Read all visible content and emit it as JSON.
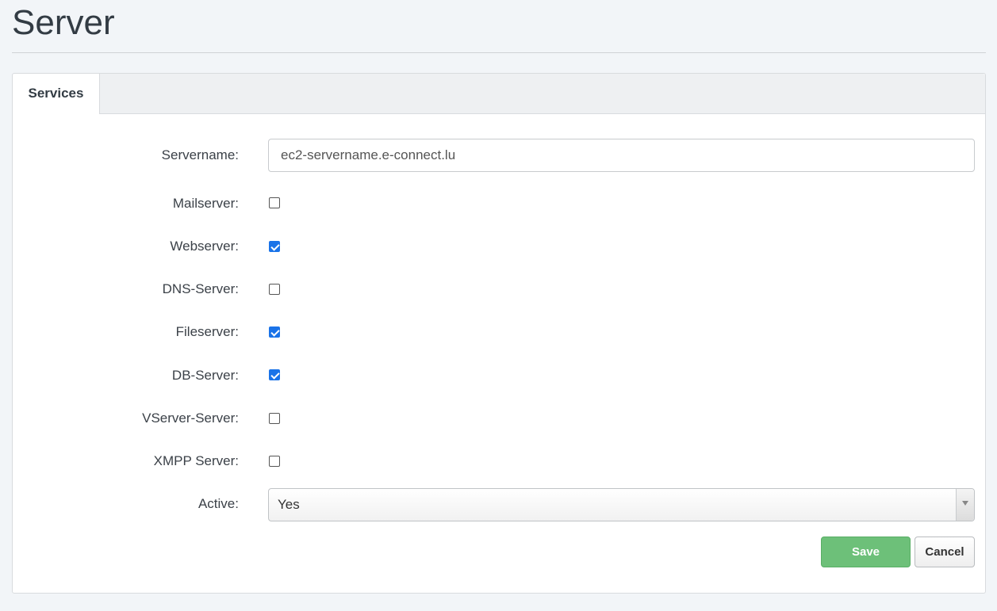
{
  "page": {
    "title": "Server"
  },
  "tabs": [
    {
      "label": "Services",
      "active": true
    }
  ],
  "form": {
    "servername": {
      "label": "Servername:",
      "value": "ec2-servername.e-connect.lu"
    },
    "mailserver": {
      "label": "Mailserver:",
      "checked": false
    },
    "webserver": {
      "label": "Webserver:",
      "checked": true
    },
    "dns_server": {
      "label": "DNS-Server:",
      "checked": false
    },
    "fileserver": {
      "label": "Fileserver:",
      "checked": true
    },
    "db_server": {
      "label": "DB-Server:",
      "checked": true
    },
    "vserver_server": {
      "label": "VServer-Server:",
      "checked": false
    },
    "xmpp_server": {
      "label": "XMPP Server:",
      "checked": false
    },
    "active": {
      "label": "Active:",
      "value": "Yes"
    }
  },
  "buttons": {
    "save_label": "Save",
    "cancel_label": "Cancel"
  },
  "colors": {
    "accent_checkbox": "#1a73e8",
    "save_button": "#6dc079",
    "background": "#f2f5f8"
  }
}
